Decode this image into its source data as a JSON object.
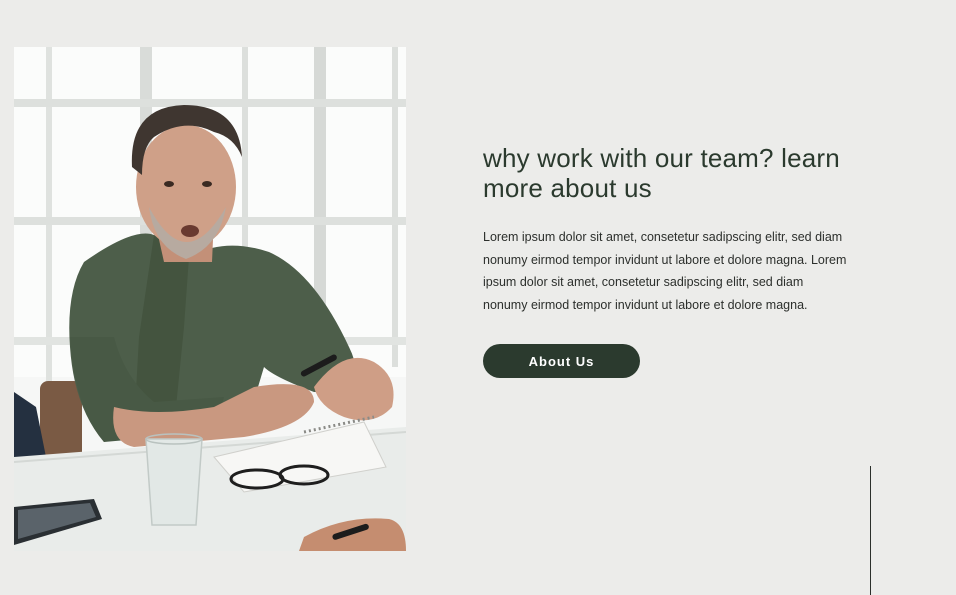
{
  "about_section": {
    "heading": "why work with our team? learn more about us",
    "body": "Lorem ipsum dolor sit amet, consetetur sadipscing elitr, sed diam nonumy eirmod tempor invidunt ut labore et dolore magna. Lorem ipsum dolor sit amet, consetetur sadipscing elitr, sed diam nonumy eirmod tempor invidunt ut labore et dolore magna.",
    "button_label": "About Us"
  },
  "colors": {
    "background": "#ececea",
    "accent_dark_green": "#2b3a2e",
    "button_text": "#ffffff"
  }
}
